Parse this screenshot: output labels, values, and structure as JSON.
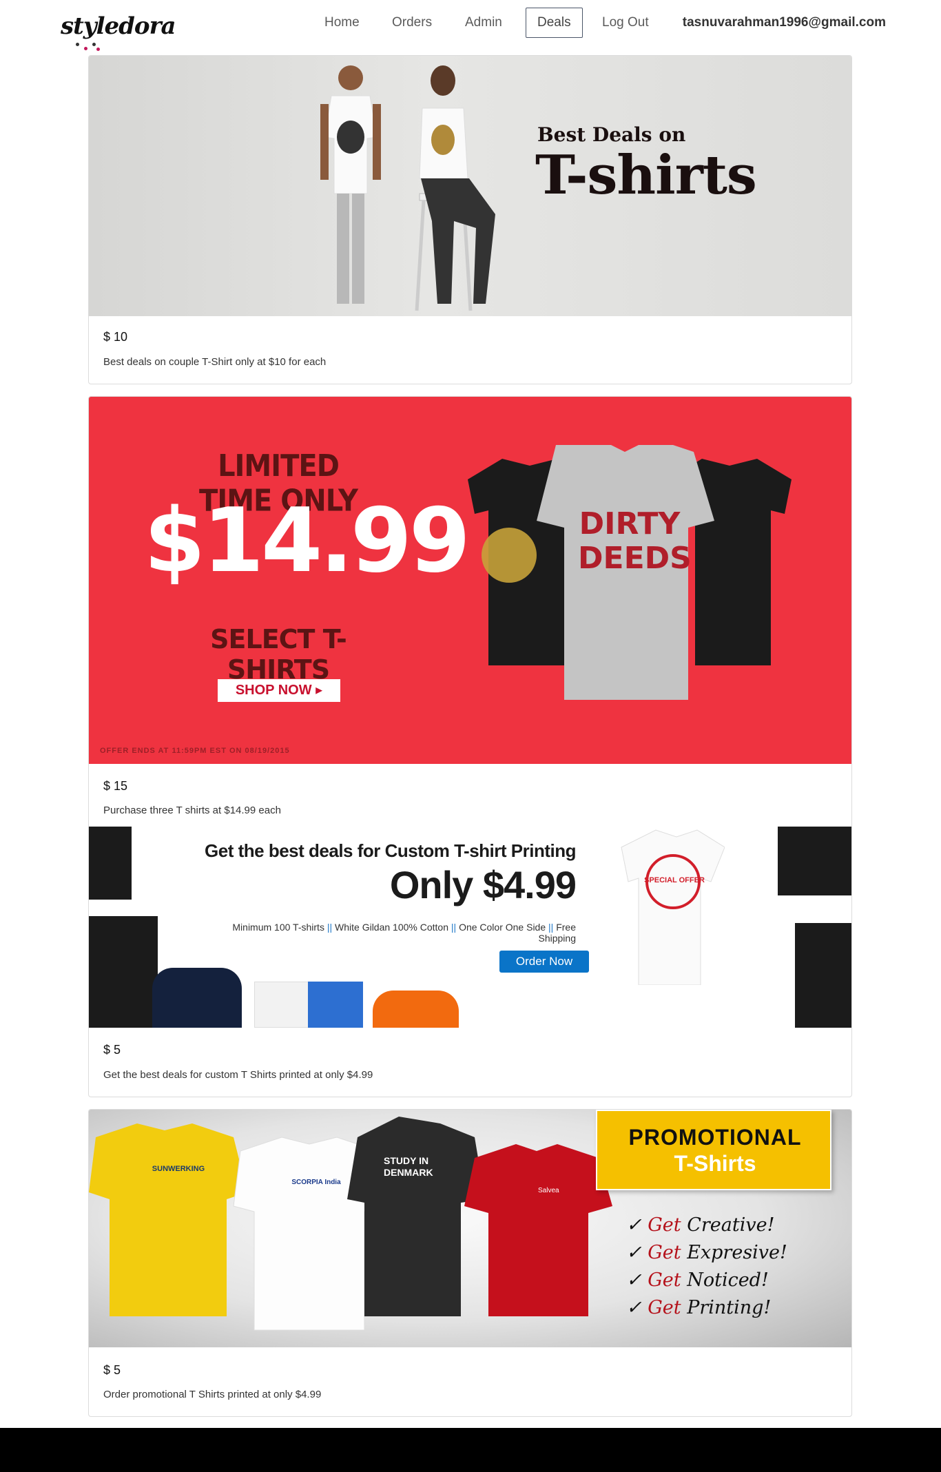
{
  "brand": {
    "logo_text": "styledora"
  },
  "nav": {
    "items": [
      {
        "label": "Home",
        "active": false
      },
      {
        "label": "Orders",
        "active": false
      },
      {
        "label": "Admin",
        "active": false
      },
      {
        "label": "Deals",
        "active": true
      },
      {
        "label": "Log Out",
        "active": false
      }
    ],
    "user_email": "tasnuvarahman1996@gmail.com"
  },
  "deals": [
    {
      "price": "$ 10",
      "description": "Best deals on couple T-Shirt only at $10 for each",
      "banner": {
        "line1": "Best Deals on",
        "line2": "T-shirts"
      }
    },
    {
      "price": "$ 15",
      "description": "Purchase three T shirts at $14.99 each",
      "banner": {
        "line1": "LIMITED TIME ONLY",
        "price": "$14.99",
        "line2": "SELECT T-SHIRTS",
        "button": "SHOP NOW ▸",
        "fine_print": "OFFER ENDS AT 11:59PM EST ON 08/19/2015",
        "shirt_text": "DIRTY DEEDS"
      }
    },
    {
      "price": "$ 5",
      "description": "Get the best deals for custom T Shirts printed at only $4.99",
      "banner": {
        "title": "Get the best deals for Custom T-shirt Printing",
        "price": "Only $4.99",
        "specs": [
          "Minimum 100 T-shirts",
          "White Gildan 100% Cotton",
          "One Color One Side",
          "Free Shipping"
        ],
        "button": "Order Now",
        "stamp": "SPECIAL OFFER"
      }
    },
    {
      "price": "$ 5",
      "description": "Order promotional T Shirts printed at only $4.99",
      "banner": {
        "heading1": "PROMOTIONAL",
        "heading2": "T-Shirts",
        "lines": [
          {
            "get": "Get",
            "rest": " Creative!"
          },
          {
            "get": "Get",
            "rest": " Expresive!"
          },
          {
            "get": "Get",
            "rest": " Noticed!"
          },
          {
            "get": "Get",
            "rest": " Printing!"
          }
        ],
        "shirt_labels": [
          "SUNWERKING",
          "SCORPIA India",
          "STUDY IN DENMARK",
          "Salvea"
        ]
      }
    }
  ],
  "colors": {
    "banner2_bg": "#ef3340",
    "accent_blue": "#0a74c8",
    "promo_yellow": "#f5c000",
    "get_red": "#b5121b"
  }
}
